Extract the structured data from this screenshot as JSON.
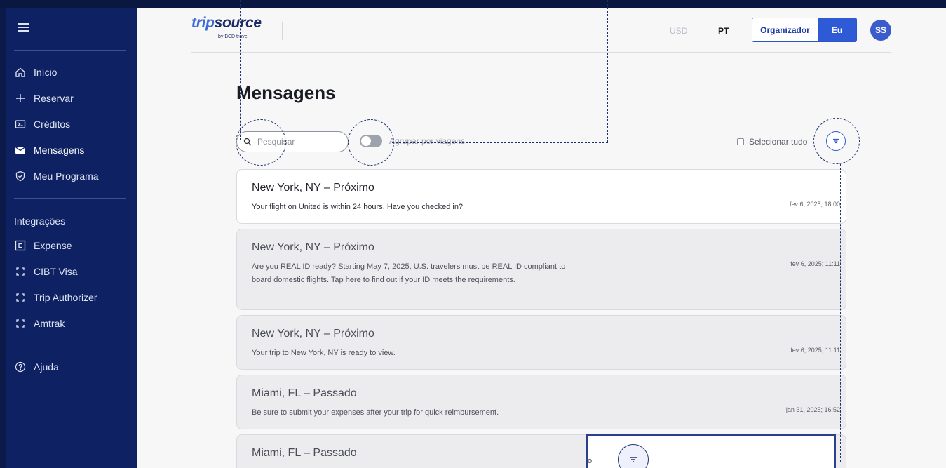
{
  "app": {
    "logo_trip": "trip",
    "logo_source": "source",
    "logo_sub": "by BCD travel",
    "currency": "USD",
    "language": "PT",
    "role_tabs": {
      "organizer": "Organizador",
      "self": "Eu"
    },
    "avatar_initials": "SS"
  },
  "sidebar": {
    "items": [
      {
        "label": "Início",
        "icon": "home-icon"
      },
      {
        "label": "Reservar",
        "icon": "plus-icon"
      },
      {
        "label": "Créditos",
        "icon": "credits-icon"
      },
      {
        "label": "Mensagens",
        "icon": "mail-icon",
        "active": true
      },
      {
        "label": "Meu Programa",
        "icon": "shield-icon"
      }
    ],
    "integrations_label": "Integrações",
    "integrations": [
      {
        "label": "Expense",
        "icon": "expense-icon"
      },
      {
        "label": "CIBT Visa",
        "icon": "external-app-icon"
      },
      {
        "label": "Trip Authorizer",
        "icon": "external-app-icon"
      },
      {
        "label": "Amtrak",
        "icon": "external-app-icon"
      }
    ],
    "help": {
      "label": "Ajuda",
      "icon": "help-icon"
    }
  },
  "main": {
    "title": "Mensagens",
    "search_placeholder": "Pesquisar",
    "group_toggle_label": "Agrupar por viagens",
    "group_toggle_on": false,
    "select_all_label": "Selecionar tudo",
    "messages": [
      {
        "title": "New York, NY – Próximo",
        "body": "Your flight on United is within 24 hours. Have you checked in?",
        "date": "fev 6, 2025; 18:00",
        "unread": true
      },
      {
        "title": "New York, NY – Próximo",
        "body": "Are you REAL ID ready? Starting May 7, 2025, U.S. travelers must be REAL ID compliant to board domestic flights. Tap here to find out if your ID meets the requirements.",
        "date": "fev 6, 2025; 11:11",
        "unread": false
      },
      {
        "title": "New York, NY – Próximo",
        "body": "Your trip to New York, NY is ready to view.",
        "date": "fev 6, 2025; 11:11",
        "unread": false
      },
      {
        "title": "Miami, FL – Passado",
        "body": "Be sure to submit your expenses after your trip for quick reimbursement.",
        "date": "jan 31, 2025; 16:52",
        "unread": false
      },
      {
        "title": "Miami, FL – Passado",
        "body": "",
        "date": "",
        "unread": false
      }
    ]
  },
  "colors": {
    "sidebar": "#0e2163",
    "accent": "#2f5ad6",
    "page_bg": "#f7f7f8"
  }
}
